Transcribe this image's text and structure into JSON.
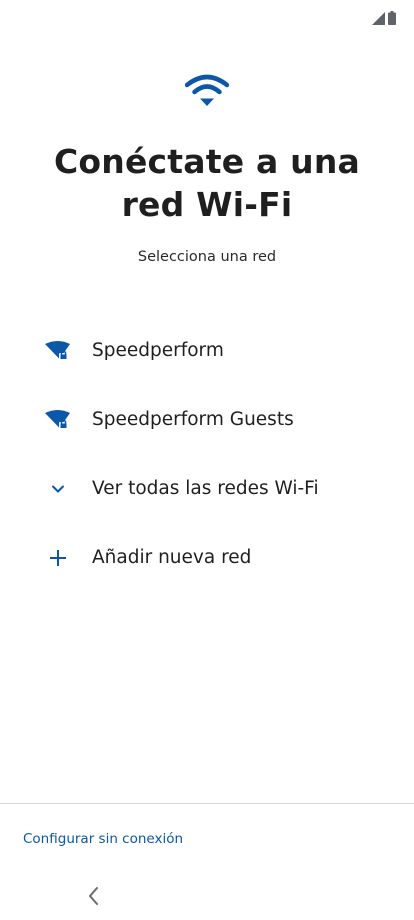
{
  "status_bar": {
    "icons": [
      "signal-icon",
      "battery-icon"
    ]
  },
  "header": {
    "icon": "wifi-icon",
    "title_line1": "Conéctate a una",
    "title_line2": "red Wi-Fi",
    "subtitle": "Selecciona una red"
  },
  "networks": [
    {
      "label": "Speedperform",
      "icon": "wifi-lock-icon"
    },
    {
      "label": "Speedperform Guests",
      "icon": "wifi-lock-icon"
    },
    {
      "label": "Ver todas las redes Wi-Fi",
      "icon": "chevron-down-icon"
    },
    {
      "label": "Añadir nueva red",
      "icon": "plus-icon"
    }
  ],
  "footer": {
    "offline_link": "Configurar sin conexión"
  },
  "nav": {
    "back_icon": "back-icon"
  },
  "colors": {
    "accent": "#0b57a8",
    "text": "#1f1f1f",
    "divider": "#dcdcdc"
  }
}
